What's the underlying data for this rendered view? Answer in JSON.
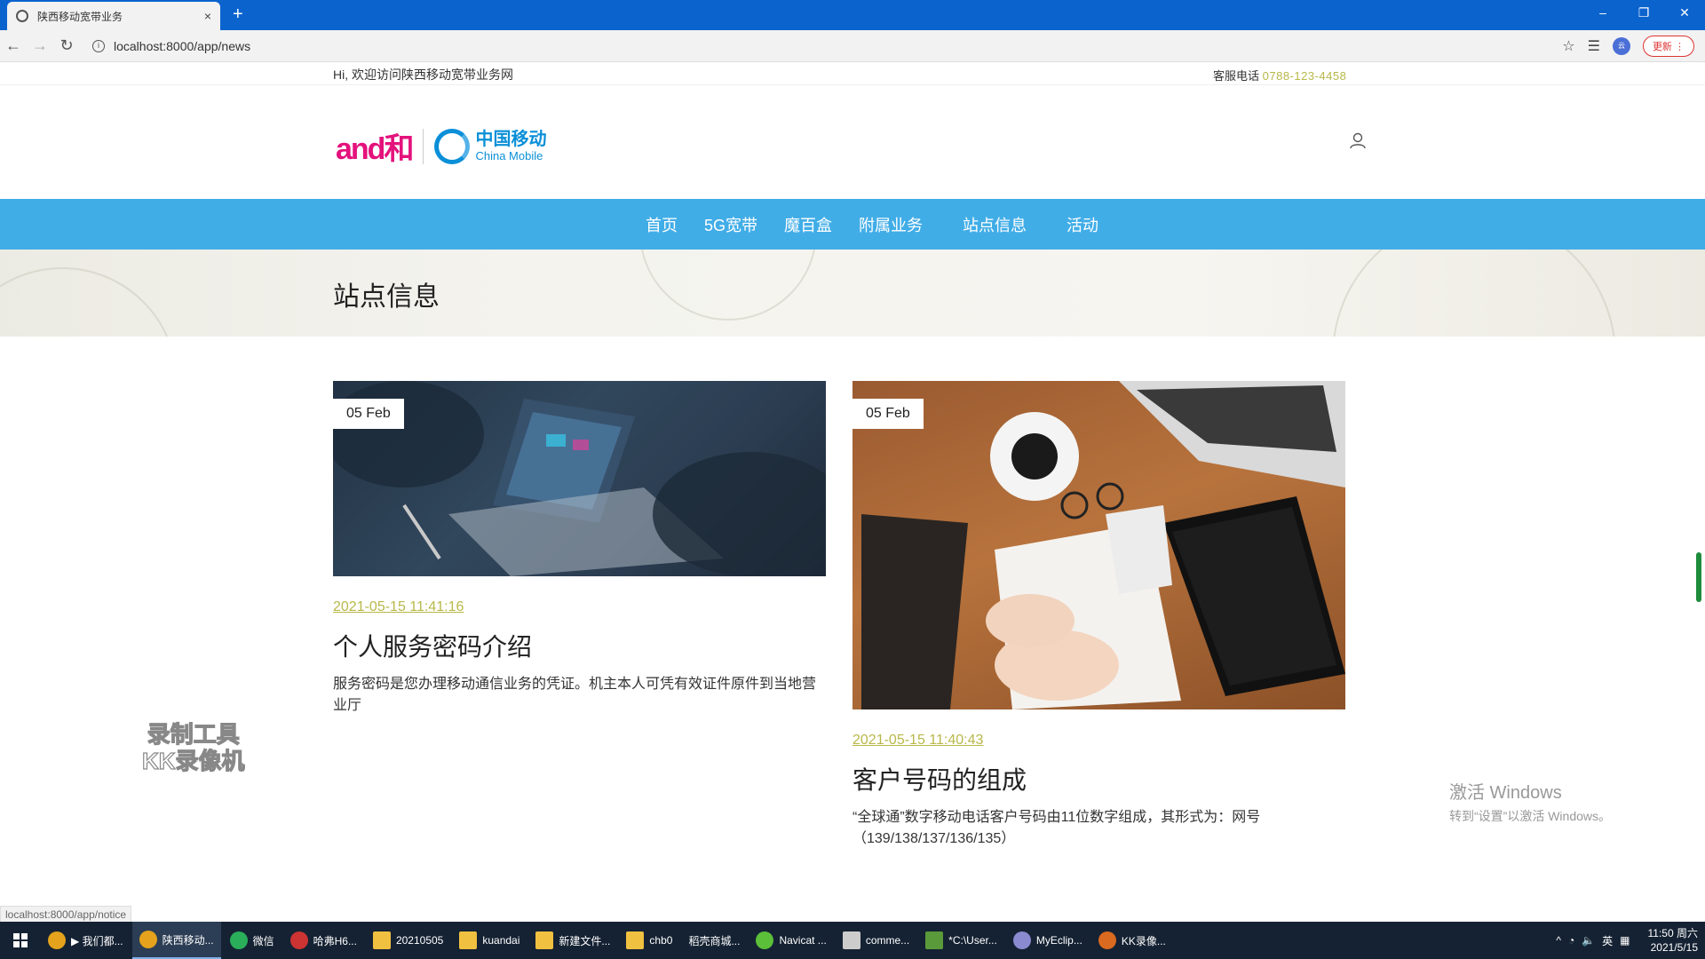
{
  "browser": {
    "tab_title": "陕西移动宽带业务",
    "close_tab": "×",
    "new_tab": "+",
    "url": "localhost:8000/app/news",
    "update_label": "更新",
    "window_controls": [
      "–",
      "❐",
      "✕"
    ]
  },
  "site": {
    "welcome": "Hi, 欢迎访问陕西移动宽带业务网",
    "hotline_label": "客服电话",
    "hotline_number": "0788-123-4458",
    "logo_and": "and和",
    "logo_cn": "中国移动",
    "logo_en": "China Mobile"
  },
  "nav": {
    "items": [
      "首页",
      "5G宽带",
      "魔百盒",
      "附属业务",
      "站点信息",
      "活动"
    ]
  },
  "banner": {
    "title": "站点信息"
  },
  "articles": [
    {
      "badge": "05 Feb",
      "timestamp": "2021-05-15 11:41:16",
      "title": "个人服务密码介绍",
      "excerpt": "服务密码是您办理移动通信业务的凭证。机主本人可凭有效证件原件到当地营业厅"
    },
    {
      "badge": "05 Feb",
      "timestamp": "2021-05-15 11:40:43",
      "title": "客户号码的组成",
      "excerpt": "“全球通”数字移动电话客户号码由11位数字组成，其形式为：网号（139/138/137/136/135）"
    }
  ],
  "overlays": {
    "kk_watermark_line1": "录制工具",
    "kk_watermark_line2": "KK录像机",
    "win_activate_1": "激活 Windows",
    "win_activate_2": "转到“设置”以激活 Windows。",
    "status_url": "localhost:8000/app/notice"
  },
  "taskbar": {
    "items": [
      "▶ 我们都...",
      "陕西移动...",
      "微信",
      "哈弗H6...",
      "20210505",
      "kuandai",
      "新建文件...",
      "chb0",
      "稻壳商城...",
      "Navicat ...",
      "comme...",
      "*C:\\User...",
      "MyEclip...",
      "KK录像..."
    ],
    "tray_ime": "英",
    "clock_time": "11:50 周六",
    "clock_date": "2021/5/15"
  },
  "colors": {
    "nav_blue": "#41ade7",
    "accent_olive": "#b8b84a",
    "tab_bar": "#0b63ce"
  }
}
